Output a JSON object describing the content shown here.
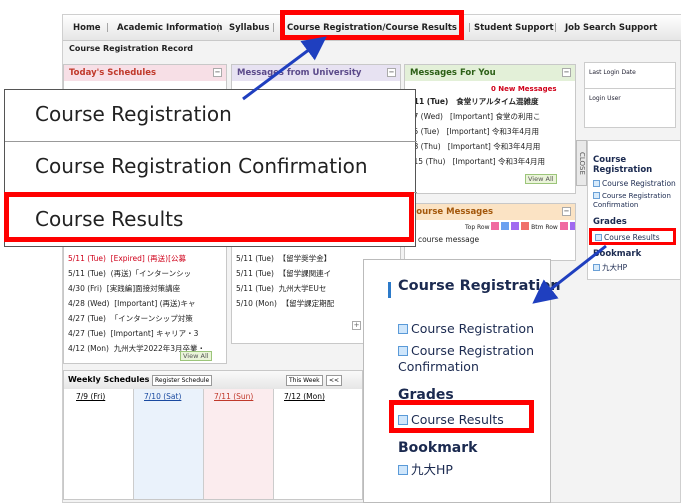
{
  "nav": {
    "items": [
      "Home",
      "Academic Information",
      "Syllabus",
      "Course Registration/Course Results",
      "Student Support",
      "Job Search Support"
    ],
    "sub": "Course Registration Record"
  },
  "panels": {
    "today": "Today's Schedules",
    "univ": "Messages from University",
    "foryou": "Messages For You",
    "course_msgs": "Course Messages",
    "course_msgs_bar": "Top Row",
    "course_msgs_bar2": "Btm Row",
    "no_course_msg": "o course message",
    "new_messages": "0 New Messages",
    "view_all": "View All",
    "foryou_rows": [
      {
        "date": "/11 (Tue)",
        "text": "食堂リアルタイム混雑度"
      },
      {
        "date": "/7 (Wed)",
        "text": "[Important] 食堂の利用こ"
      },
      {
        "date": "/5 (Tue)",
        "text": "[Important] 令和3年4月用"
      },
      {
        "date": "/8 (Thu)",
        "text": "[Important] 令和3年4月用"
      },
      {
        "date": "/15 (Thu)",
        "text": "[Important] 令和3年4月用"
      }
    ],
    "left_rows": [
      {
        "date": "5/11 (Tue)",
        "text": "[Expired] (再送)[公募"
      },
      {
        "date": "5/11 (Tue)",
        "text": "(再送)「インターンシッ"
      },
      {
        "date": "4/30 (Fri)",
        "text": "[実践編]面接対策講座"
      },
      {
        "date": "4/28 (Wed)",
        "text": "[Important] (再送)キャ"
      },
      {
        "date": "4/27 (Tue)",
        "text": "「インターンシップ対策"
      },
      {
        "date": "4/27 (Tue)",
        "text": "[Important] キャリア・3"
      },
      {
        "date": "4/12 (Mon)",
        "text": "九州大学2022年3月卒業・"
      }
    ],
    "mid_rows": [
      {
        "date": "5/11 (Tue)",
        "text": "【留学奨学金】"
      },
      {
        "date": "5/11 (Tue)",
        "text": "【留学課関連イ"
      },
      {
        "date": "5/11 (Tue)",
        "text": "九州大学EUセ"
      },
      {
        "date": "5/10 (Mon)",
        "text": "【留学課定期配"
      }
    ]
  },
  "weekly": {
    "title": "Weekly Schedules",
    "register": "Register Schedule",
    "this_week": "This Week",
    "prev": "<<",
    "dates": [
      "7/9 (Fri)",
      "7/10 (Sat)",
      "7/11 (Sun)",
      "7/12 (Mon)"
    ]
  },
  "right": {
    "last_login": "Last Login Date",
    "login_user": "Login User",
    "close": "CLOSE",
    "course_reg": "Course Registration",
    "reg_item": "Course Registration",
    "reg_confirm": "Course Registration Confirmation",
    "grades": "Grades",
    "results": "Course Results",
    "bookmark": "Bookmark",
    "bm_item": "九大HP"
  },
  "popup": {
    "items": [
      "Course Registration",
      "Course Registration Confirmation",
      "Course Results"
    ]
  },
  "colors": {
    "highlight": "#ff0000",
    "arrow": "#1f3fbf",
    "link": "#1b2a50"
  }
}
